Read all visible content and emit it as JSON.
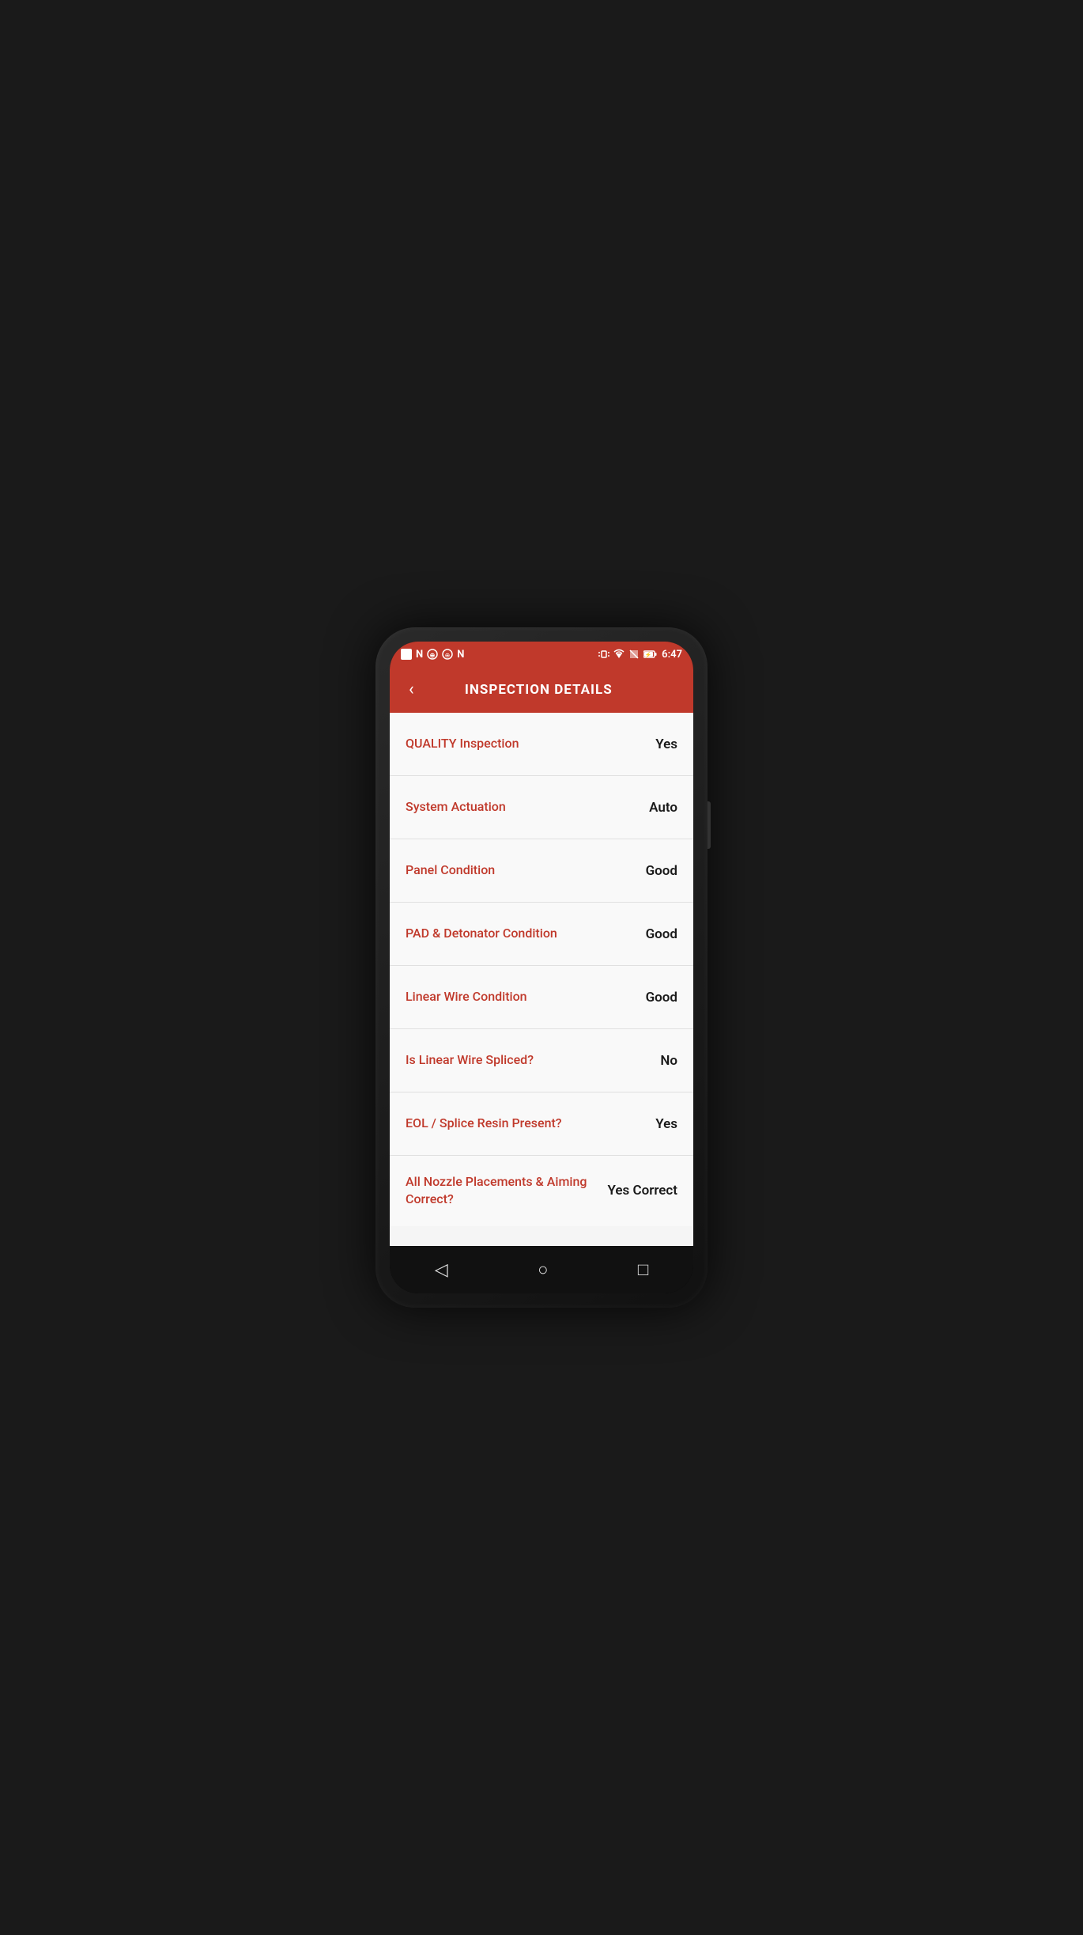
{
  "statusBar": {
    "time": "6:47",
    "icons": {
      "vibrate": "📳",
      "wifi": "▼",
      "battery": "⚡"
    }
  },
  "header": {
    "title": "INSPECTION DETAILS",
    "backLabel": "‹"
  },
  "rows": [
    {
      "label": "QUALITY Inspection",
      "value": "Yes"
    },
    {
      "label": "System Actuation",
      "value": "Auto"
    },
    {
      "label": "Panel Condition",
      "value": "Good"
    },
    {
      "label": "PAD & Detonator Condition",
      "value": "Good"
    },
    {
      "label": "Linear Wire Condition",
      "value": "Good"
    },
    {
      "label": "Is Linear Wire Spliced?",
      "value": "No"
    },
    {
      "label": "EOL / Splice Resin Present?",
      "value": "Yes"
    },
    {
      "label": "All Nozzle Placements & Aiming Correct?",
      "value": "Yes Correct"
    }
  ],
  "bottomNav": {
    "back": "◁",
    "home": "○",
    "recent": "□"
  }
}
